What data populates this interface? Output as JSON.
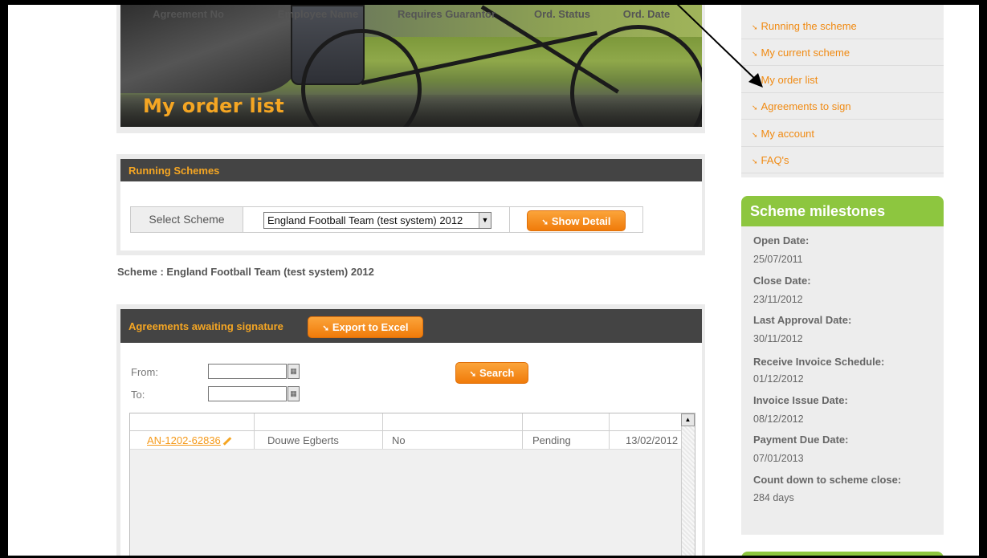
{
  "banner": {
    "title": "My order list"
  },
  "running_schemes": {
    "title": "Running Schemes",
    "select_label": "Select Scheme",
    "selected_scheme": "England Football Team (test system) 2012",
    "show_detail_label": "Show Detail"
  },
  "scheme_line": "Scheme : England Football Team (test system) 2012",
  "agreements": {
    "title": "Agreements awaiting signature",
    "export_label": "Export to Excel",
    "from_label": "From:",
    "to_label": "To:",
    "search_label": "Search",
    "columns": [
      "Agreement No",
      "Employee Name",
      "Requires Guarantor",
      "Ord. Status",
      "Ord. Date"
    ],
    "rows": [
      {
        "agreement_no": "AN-1202-62836",
        "employee": "Douwe Egberts",
        "guarantor": "No",
        "status": "Pending",
        "date": "13/02/2012"
      }
    ]
  },
  "nav": {
    "items": [
      "Running the scheme",
      "My current scheme",
      "My order list",
      "Agreements to sign",
      "My account",
      "FAQ's"
    ]
  },
  "milestones": {
    "title": "Scheme milestones",
    "entries": [
      {
        "label": "Open Date:",
        "value": "25/07/2011"
      },
      {
        "label": "Close Date:",
        "value": "23/11/2012"
      },
      {
        "label": "Last Approval Date:",
        "value": "30/11/2012"
      },
      {
        "label": "Receive Invoice Schedule:",
        "value": "01/12/2012"
      },
      {
        "label": "Invoice Issue Date:",
        "value": "08/12/2012"
      },
      {
        "label": "Payment Due Date:",
        "value": "07/01/2013"
      },
      {
        "label": "Count down to scheme close:",
        "value": "284 days"
      }
    ]
  },
  "icons": {
    "bullet": "double-chevron-right-icon",
    "calendar": "calendar-icon",
    "edit": "pencil-icon",
    "dropdown": "dropdown-arrow-icon",
    "scroll_up": "scroll-up-icon"
  },
  "colors": {
    "accent_orange": "#f5a623",
    "button_orange": "#f07b0a",
    "header_dark": "#444444",
    "milestone_green": "#8dc63f"
  }
}
